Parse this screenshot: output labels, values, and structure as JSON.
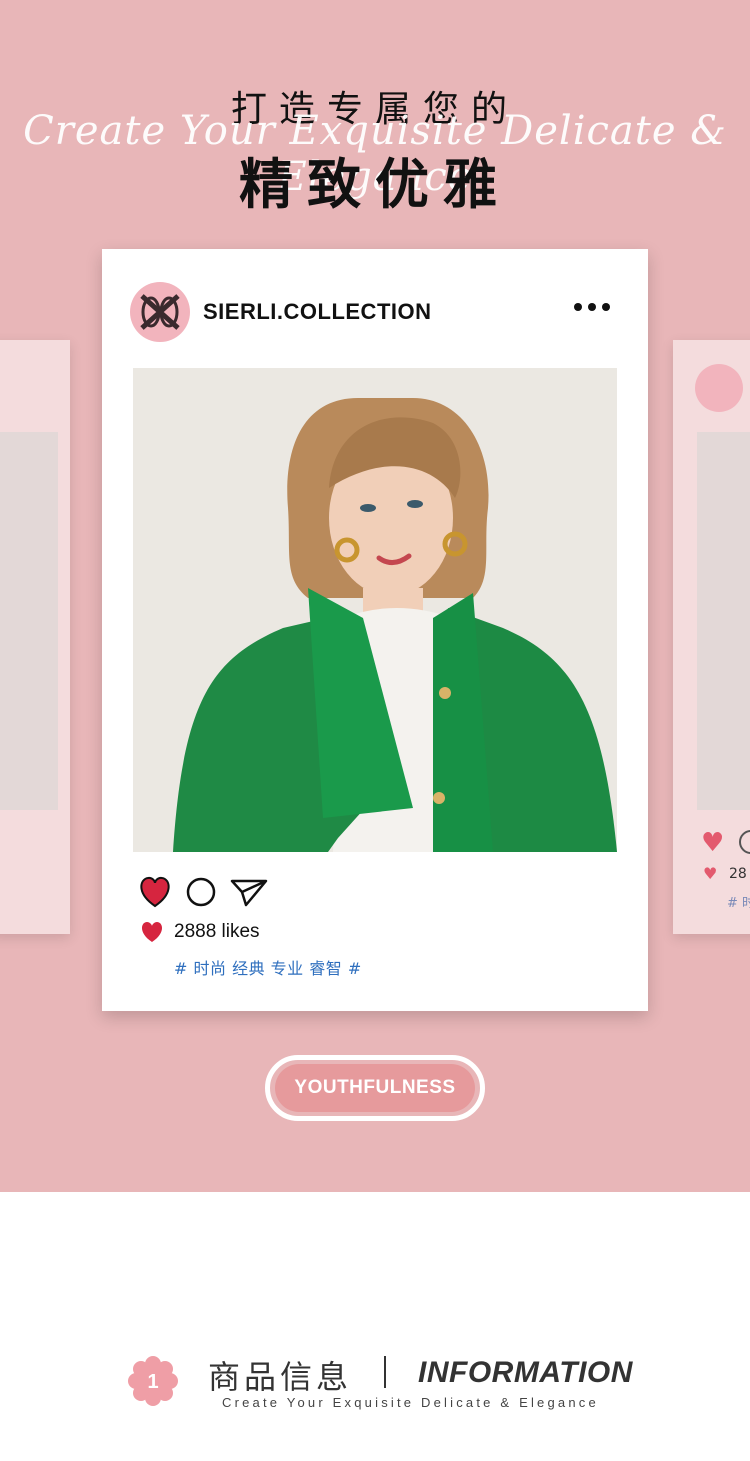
{
  "header": {
    "title_top": "打造专属您的",
    "title_script": "Create Your Exquisite Delicate & Elegance",
    "title_main": "精致优雅"
  },
  "post": {
    "handle": "SIERLI.COLLECTION",
    "likes_text": "2888 likes",
    "tags": "# 时尚 经典 专业 睿智 #"
  },
  "side_card_right": {
    "likes_partial": "28",
    "tag_partial": "# 时"
  },
  "badge": {
    "label": "YOUTHFULNESS"
  },
  "info": {
    "number": "1",
    "title_cn": "商品信息",
    "title_en": "INFORMATION",
    "subtitle": "Create Your Exquisite Delicate & Elegance"
  },
  "colors": {
    "hero_background": "#e8b6b8",
    "accent_pink": "#f2b4bd",
    "like_red": "#d6253f",
    "tag_blue": "#2f6fbe",
    "badge_fill": "#e69a9c"
  },
  "icons": {
    "more": "more-dots-icon",
    "like": "heart-icon",
    "comment": "comment-circle-icon",
    "share": "send-icon"
  }
}
